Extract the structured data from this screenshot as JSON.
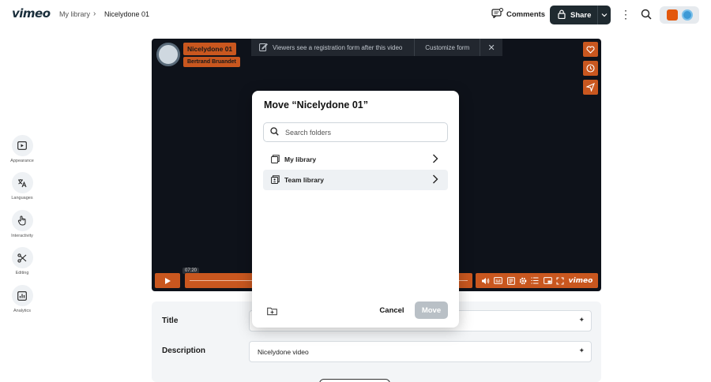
{
  "header": {
    "logo": "vimeo",
    "breadcrumb": [
      "My library",
      "Nicelydone 01"
    ],
    "comments_label": "Comments",
    "share_label": "Share"
  },
  "sidebar": {
    "items": [
      {
        "label": "Appearance",
        "icon": "appearance-icon"
      },
      {
        "label": "Languages",
        "icon": "languages-icon"
      },
      {
        "label": "Interactivity",
        "icon": "interactivity-icon"
      },
      {
        "label": "Editing",
        "icon": "editing-icon"
      },
      {
        "label": "Analytics",
        "icon": "analytics-icon"
      }
    ]
  },
  "video": {
    "title_tag": "Nicelydone 01",
    "author_tag": "Bertrand Bruandet",
    "banner_text": "Viewers see a registration form after this video",
    "banner_action": "Customize form",
    "timestamp": "07:20",
    "brand": "vimeo",
    "accent_color": "#c9571f"
  },
  "details": {
    "title_label": "Title",
    "description_label": "Description",
    "description_value": "Nicelydone video"
  },
  "modal": {
    "title": "Move “Nicelydone 01”",
    "search_placeholder": "Search folders",
    "folders": [
      {
        "label": "My library"
      },
      {
        "label": "Team library"
      }
    ],
    "cancel_label": "Cancel",
    "move_label": "Move"
  }
}
